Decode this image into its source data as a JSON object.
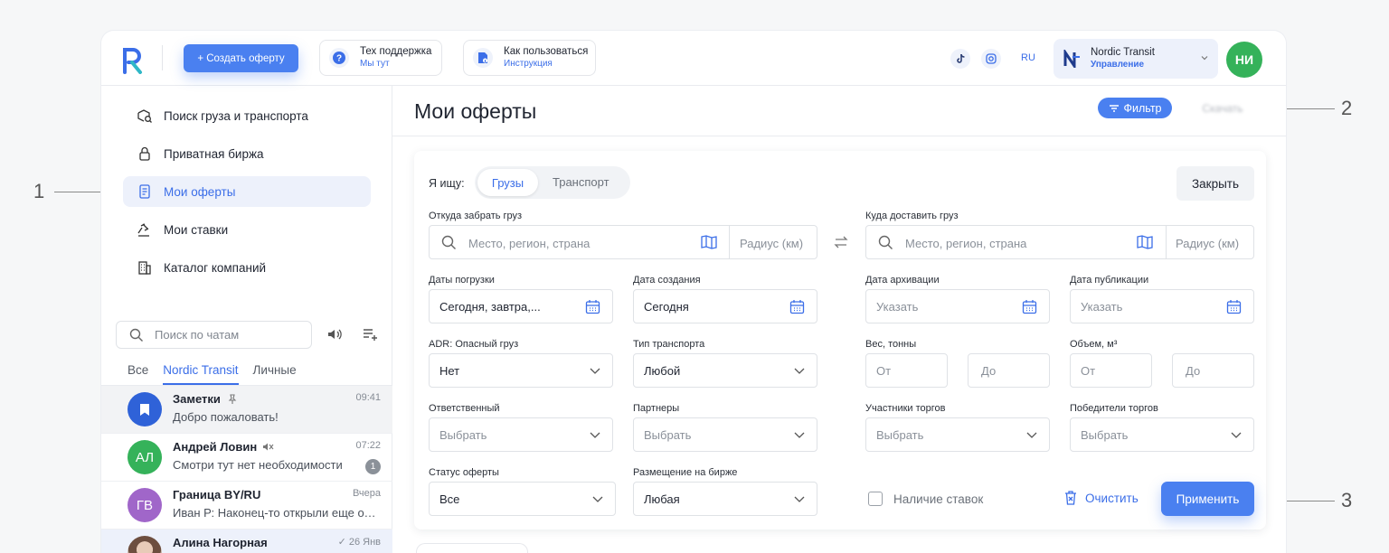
{
  "topbar": {
    "create_label": "+ Создать оферту",
    "support": {
      "title": "Тех поддержка",
      "sub": "Мы тут"
    },
    "howto": {
      "title": "Как пользоваться",
      "sub": "Инструкция"
    },
    "lang": "RU",
    "company": {
      "name": "Nordic Transit",
      "role": "Управление"
    },
    "avatar_initials": "НИ"
  },
  "sidebar": {
    "nav": [
      {
        "label": "Поиск груза и транспорта",
        "icon": "cargo-search-icon"
      },
      {
        "label": "Приватная биржа",
        "icon": "lock-icon"
      },
      {
        "label": "Мои оферты",
        "icon": "document-icon",
        "active": true
      },
      {
        "label": "Мои ставки",
        "icon": "gavel-icon"
      },
      {
        "label": "Каталог компаний",
        "icon": "building-icon"
      }
    ],
    "chat_search_placeholder": "Поиск по чатам",
    "chat_tabs": [
      "Все",
      "Nordic Transit",
      "Личные"
    ],
    "chats": [
      {
        "name": "Заметки",
        "message": "Добро пожаловать!",
        "time": "09:41",
        "avatar": "bookmark",
        "color": "#2f62d8",
        "pinned": true
      },
      {
        "name": "Андрей Ловин",
        "message": "Смотри тут нет необходимости",
        "time": "07:22",
        "avatar": "АЛ",
        "color": "#35b25a",
        "muted": true,
        "badge": "1"
      },
      {
        "name": "Граница BY/RU",
        "message": "Иван Р: Наконец-то открыли еще один пункт",
        "time": "Вчера",
        "avatar": "ГВ",
        "color": "#a066c9"
      },
      {
        "name": "Алина Нагорная",
        "message": "",
        "time": "✓ 26 Янв",
        "avatar": "photo",
        "color": "#b89a88"
      }
    ]
  },
  "main": {
    "title": "Мои оферты",
    "filter_label": "Фильтр",
    "export_label": "Скачать",
    "search_for_label": "Я ищу:",
    "seg": [
      "Грузы",
      "Транспорт"
    ],
    "close_label": "Закрыть",
    "from": {
      "label": "Откуда забрать груз",
      "placeholder": "Место, регион, страна",
      "radius": "Радиус (км)"
    },
    "to": {
      "label": "Куда доставить груз",
      "placeholder": "Место, регион, страна",
      "radius": "Радиус (км)"
    },
    "load_dates": {
      "label": "Даты погрузки",
      "value": "Сегодня, завтра,..."
    },
    "created": {
      "label": "Дата создания",
      "value": "Сегодня"
    },
    "archived": {
      "label": "Дата архивации",
      "value": "Указать"
    },
    "published": {
      "label": "Дата публикации",
      "value": "Указать"
    },
    "adr": {
      "label": "ADR: Опасный груз",
      "value": "Нет"
    },
    "transport_type": {
      "label": "Тип транспорта",
      "value": "Любой"
    },
    "weight": {
      "label": "Вес, тонны",
      "from": "От",
      "to": "До"
    },
    "volume": {
      "label": "Объем, м³",
      "from": "От",
      "to": "До"
    },
    "responsible": {
      "label": "Ответственный",
      "value": "Выбрать"
    },
    "partners": {
      "label": "Партнеры",
      "value": "Выбрать"
    },
    "bidders": {
      "label": "Участники торгов",
      "value": "Выбрать"
    },
    "winners": {
      "label": "Победители торгов",
      "value": "Выбрать"
    },
    "status": {
      "label": "Статус оферты",
      "value": "Все"
    },
    "placement": {
      "label": "Размещение на бирже",
      "value": "Любая"
    },
    "has_bids_label": "Наличие ставок",
    "clear_label": "Очистить",
    "apply_label": "Применить"
  },
  "callouts": [
    "1",
    "2",
    "3"
  ],
  "colors": {
    "accent": "#4a80f0",
    "active_bg": "#edf1fb",
    "green": "#35b25a"
  }
}
